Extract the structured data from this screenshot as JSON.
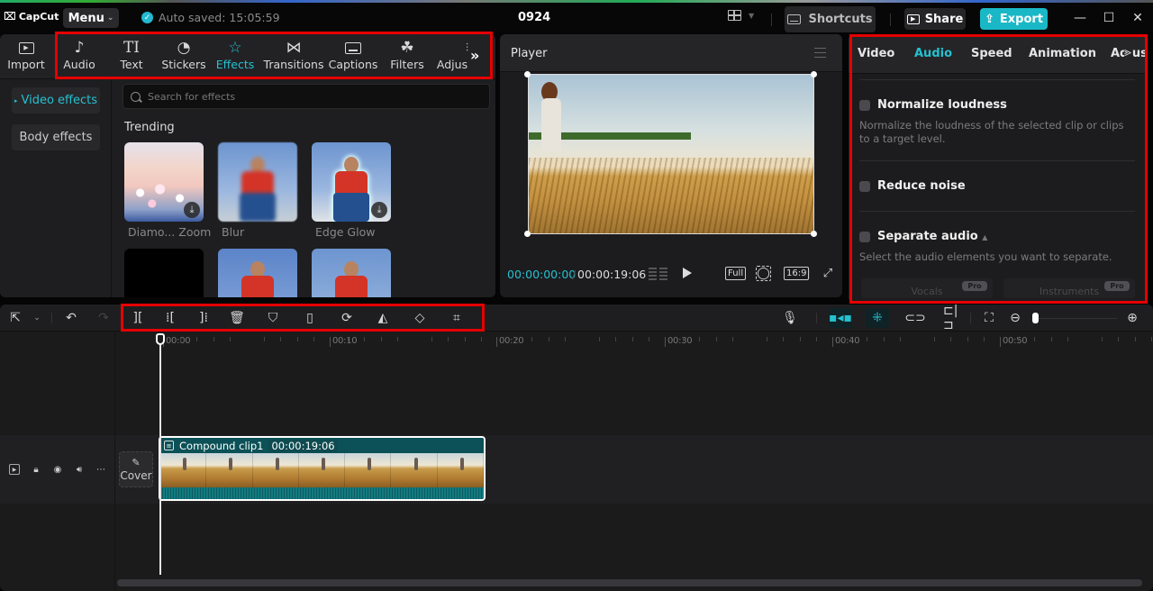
{
  "app": {
    "logo_text": "CapCut",
    "menu_label": "Menu",
    "autosave_text": "Auto saved: 15:05:59",
    "project_title": "0924",
    "shortcuts_label": "Shortcuts",
    "share_label": "Share",
    "export_label": "Export",
    "accent_color": "#1ab8c7"
  },
  "media_toolbar": {
    "tabs": [
      {
        "label": "Import",
        "icon": "import-icon"
      },
      {
        "label": "Audio",
        "icon": "audio-icon"
      },
      {
        "label": "Text",
        "icon": "text-icon"
      },
      {
        "label": "Stickers",
        "icon": "stickers-icon"
      },
      {
        "label": "Effects",
        "icon": "effects-icon",
        "active": true
      },
      {
        "label": "Transitions",
        "icon": "transitions-icon"
      },
      {
        "label": "Captions",
        "icon": "captions-icon"
      },
      {
        "label": "Filters",
        "icon": "filters-icon"
      },
      {
        "label": "Adjus",
        "icon": "adjustment-icon"
      }
    ],
    "more_glyph": "»"
  },
  "effects_panel": {
    "categories": [
      {
        "label": "Video effects",
        "active": true
      },
      {
        "label": "Body effects"
      }
    ],
    "search_placeholder": "Search for effects",
    "section_title": "Trending",
    "items": [
      {
        "label": "Diamo... Zoom",
        "downloadable": true
      },
      {
        "label": "Blur",
        "downloadable": false
      },
      {
        "label": "Edge Glow",
        "downloadable": true
      }
    ]
  },
  "player": {
    "title": "Player",
    "current_time": "00:00:00:00",
    "total_time": "00:00:19:06",
    "full_label": "Full",
    "ratio_label": "16:9"
  },
  "properties": {
    "tabs": [
      {
        "label": "Video"
      },
      {
        "label": "Audio",
        "active": true
      },
      {
        "label": "Speed"
      },
      {
        "label": "Animation"
      },
      {
        "label": "Adjust"
      }
    ],
    "options": [
      {
        "title": "Normalize loudness",
        "desc": "Normalize the loudness of the selected clip or clips to a target level.",
        "checked": false
      },
      {
        "title": "Reduce noise",
        "checked": false
      },
      {
        "title": "Separate audio",
        "desc": "Select the audio elements you want to separate.",
        "checked": false
      }
    ],
    "separate_choices": [
      {
        "label": "Vocals",
        "badge": "Pro"
      },
      {
        "label": "Instruments",
        "badge": "Pro"
      }
    ]
  },
  "timeline": {
    "ruler_labels": [
      "00:00",
      "00:10",
      "00:20",
      "00:30",
      "00:40",
      "00:50"
    ],
    "cover_label": "Cover",
    "clip": {
      "name": "Compound clip1",
      "duration": "00:00:19:06"
    }
  }
}
